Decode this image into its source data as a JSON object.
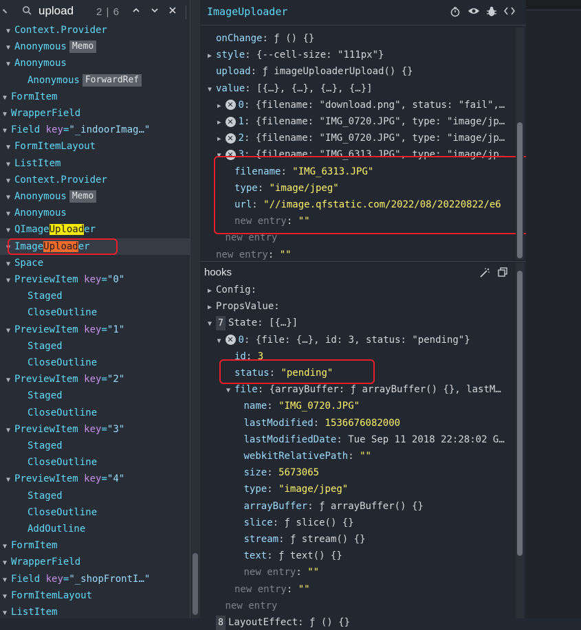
{
  "search": {
    "query": "upload",
    "count": "2 | 6"
  },
  "tree": [
    {
      "text": "Context.Provider",
      "indent": 1
    },
    {
      "text": "Anonymous",
      "badge": "Memo",
      "indent": 1
    },
    {
      "text": "Anonymous",
      "indent": 1
    },
    {
      "text": "Anonymous",
      "badge": "ForwardRef",
      "indent": 2,
      "noarrow": true
    },
    {
      "text": "FormItem",
      "indent": 0
    },
    {
      "text": "WrapperField",
      "indent": 0
    },
    {
      "text": "Field",
      "key": "\"_indoorImag…\"",
      "indent": 0
    },
    {
      "text": "FormItemLayout",
      "indent": 1
    },
    {
      "text": "ListItem",
      "indent": 1
    },
    {
      "text": "Context.Provider",
      "indent": 1
    },
    {
      "text": "Anonymous",
      "badge": "Memo",
      "indent": 1
    },
    {
      "text": "Anonymous",
      "indent": 1
    },
    {
      "text": "QImageUploader",
      "indent": 1,
      "hl": "yellow"
    },
    {
      "text": "ImageUploader",
      "indent": 1,
      "hl": "orange",
      "selected": true
    },
    {
      "text": "Space",
      "indent": 1
    },
    {
      "text": "PreviewItem",
      "key": "\"0\"",
      "indent": 1
    },
    {
      "text": "Staged",
      "indent": 2,
      "noarrow": true
    },
    {
      "text": "CloseOutline",
      "indent": 2,
      "noarrow": true
    },
    {
      "text": "PreviewItem",
      "key": "\"1\"",
      "indent": 1
    },
    {
      "text": "Staged",
      "indent": 2,
      "noarrow": true
    },
    {
      "text": "CloseOutline",
      "indent": 2,
      "noarrow": true
    },
    {
      "text": "PreviewItem",
      "key": "\"2\"",
      "indent": 1
    },
    {
      "text": "Staged",
      "indent": 2,
      "noarrow": true
    },
    {
      "text": "CloseOutline",
      "indent": 2,
      "noarrow": true
    },
    {
      "text": "PreviewItem",
      "key": "\"3\"",
      "indent": 1
    },
    {
      "text": "Staged",
      "indent": 2,
      "noarrow": true
    },
    {
      "text": "CloseOutline",
      "indent": 2,
      "noarrow": true
    },
    {
      "text": "PreviewItem",
      "key": "\"4\"",
      "indent": 1
    },
    {
      "text": "Staged",
      "indent": 2,
      "noarrow": true
    },
    {
      "text": "CloseOutline",
      "indent": 2,
      "noarrow": true
    },
    {
      "text": "AddOutline",
      "indent": 2,
      "noarrow": true
    },
    {
      "text": "FormItem",
      "indent": 0
    },
    {
      "text": "WrapperField",
      "indent": 0
    },
    {
      "text": "Field",
      "key": "\"_shopFrontI…\"",
      "indent": 0
    },
    {
      "text": "FormItemLayout",
      "indent": 0
    },
    {
      "text": "ListItem",
      "indent": 0
    }
  ],
  "component": {
    "title": "ImageUploader"
  },
  "props": [
    {
      "key": "onChange",
      "val": "ƒ () {}",
      "vtype": "w"
    },
    {
      "key": "style",
      "val": "{--cell-size: \"111px\"}",
      "vtype": "w",
      "arrow": true
    },
    {
      "key": "upload",
      "val": "ƒ imageUploaderUpload() {}",
      "vtype": "w"
    },
    {
      "key": "value",
      "val": "[{…}, {…}, {…}, {…}]",
      "vtype": "w",
      "arrow": "open"
    },
    {
      "key": "0",
      "val": "{filename: \"download.png\", status: \"fail\",…",
      "vtype": "w",
      "arrow": true,
      "x": true,
      "lvl": 1
    },
    {
      "key": "1",
      "val": "{filename: \"IMG_0720.JPG\", type: \"image/jp…",
      "vtype": "w",
      "arrow": true,
      "x": true,
      "lvl": 1
    },
    {
      "key": "2",
      "val": "{filename: \"IMG_0720.JPG\", type: \"image/jp…",
      "vtype": "w",
      "arrow": true,
      "x": true,
      "lvl": 1
    },
    {
      "key": "3",
      "val": "{filename: \"IMG_6313.JPG\", type: \"image/jp…",
      "vtype": "w",
      "arrow": "open",
      "x": true,
      "lvl": 1
    },
    {
      "key": "filename",
      "val": "\"IMG_6313.JPG\"",
      "vtype": "s",
      "lvl": 2
    },
    {
      "key": "type",
      "val": "\"image/jpeg\"",
      "vtype": "s",
      "lvl": 2
    },
    {
      "key": "url",
      "val": "\"//image.qfstatic.com/2022/08/20220822/e6",
      "vtype": "s",
      "lvl": 2
    },
    {
      "key": "new entry",
      "val": "\"\"",
      "vtype": "s",
      "lvl": 2,
      "dimkey": true
    },
    {
      "key": "new entry",
      "val": "",
      "vtype": "w",
      "lvl": 1,
      "dimkey": true
    },
    {
      "key": "new entry",
      "val": "\"\"",
      "vtype": "s",
      "lvl": 0,
      "dimkey": true
    }
  ],
  "hooks": {
    "title": "hooks",
    "rows": [
      {
        "key": "Config:",
        "val": "",
        "vtype": "w",
        "arrow": true,
        "lvl": 0,
        "plainkey": true
      },
      {
        "key": "PropsValue:",
        "val": "",
        "vtype": "w",
        "arrow": true,
        "lvl": 0,
        "plainkey": true
      },
      {
        "key": "State:",
        "val": "[{…}]",
        "vtype": "w",
        "arrow": "open",
        "lvl": 0,
        "plainkey": true,
        "num": "7"
      },
      {
        "key": "0",
        "val": "{file: {…}, id: 3, status: \"pending\"}",
        "vtype": "w",
        "arrow": "open",
        "x": true,
        "lvl": 1
      },
      {
        "key": "id",
        "val": "3",
        "vtype": "n",
        "lvl": 2
      },
      {
        "key": "status",
        "val": "\"pending\"",
        "vtype": "s",
        "lvl": 2
      },
      {
        "key": "file",
        "val": "{arrayBuffer: ƒ arrayBuffer() {}, lastM…",
        "vtype": "w",
        "arrow": "open",
        "lvl": 2
      },
      {
        "key": "name",
        "val": "\"IMG_0720.JPG\"",
        "vtype": "s",
        "lvl": 3
      },
      {
        "key": "lastModified",
        "val": "1536676082000",
        "vtype": "n",
        "lvl": 3
      },
      {
        "key": "lastModifiedDate",
        "val": "Tue Sep 11 2018 22:28:02 G…",
        "vtype": "w",
        "lvl": 3
      },
      {
        "key": "webkitRelativePath",
        "val": "\"\"",
        "vtype": "s",
        "lvl": 3
      },
      {
        "key": "size",
        "val": "5673065",
        "vtype": "n",
        "lvl": 3
      },
      {
        "key": "type",
        "val": "\"image/jpeg\"",
        "vtype": "s",
        "lvl": 3
      },
      {
        "key": "arrayBuffer",
        "val": "ƒ arrayBuffer() {}",
        "vtype": "w",
        "lvl": 3
      },
      {
        "key": "slice",
        "val": "ƒ slice() {}",
        "vtype": "w",
        "lvl": 3
      },
      {
        "key": "stream",
        "val": "ƒ stream() {}",
        "vtype": "w",
        "lvl": 3
      },
      {
        "key": "text",
        "val": "ƒ text() {}",
        "vtype": "w",
        "lvl": 3
      },
      {
        "key": "new entry",
        "val": "\"\"",
        "vtype": "s",
        "lvl": 3,
        "dimkey": true
      },
      {
        "key": "new entry",
        "val": "\"\"",
        "vtype": "s",
        "lvl": 2,
        "dimkey": true
      },
      {
        "key": "new entry",
        "val": "",
        "vtype": "w",
        "lvl": 1,
        "dimkey": true
      },
      {
        "key": "LayoutEffect:",
        "val": "ƒ () {}",
        "vtype": "w",
        "lvl": 0,
        "plainkey": true,
        "num": "8"
      }
    ]
  },
  "icons": {
    "timer": "stopwatch-icon",
    "eye": "eye-icon",
    "bug": "bug-icon",
    "code": "code-icon",
    "wand": "magic-wand-icon",
    "copy": "copy-icon"
  }
}
